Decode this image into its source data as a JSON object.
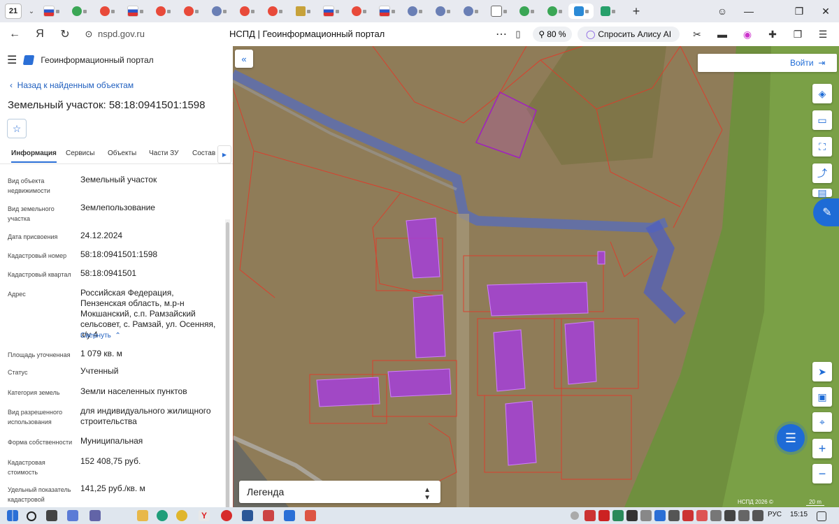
{
  "browser": {
    "tab_count": "21",
    "url": "nspd.gov.ru",
    "page_title": "НСПД | Геоинформационный портал",
    "zoom": "80 %",
    "alice_label": "Спросить Алису AI"
  },
  "panel": {
    "portal_title": "Геоинформационный портал",
    "back_label": "Назад к найденным объектам",
    "object_title": "Земельный участок: 58:18:0941501:1598",
    "tabs": [
      "Информация",
      "Сервисы",
      "Объекты",
      "Части ЗУ",
      "Состав"
    ],
    "fields": [
      {
        "label": "Вид объекта недвижимости",
        "value": "Земельный участок"
      },
      {
        "label": "Вид земельного участка",
        "value": "Землепользование"
      },
      {
        "label": "Дата присвоения",
        "value": "24.12.2024"
      },
      {
        "label": "Кадастровый номер",
        "value": "58:18:0941501:1598"
      },
      {
        "label": "Кадастровый квартал",
        "value": "58:18:0941501"
      },
      {
        "label": "Адрес",
        "value": "Российская Федерация, Пензенская область, м.р-н Мокшанский, с.п. Рамзайский сельсовет, с. Рамзай, ул. Осенняя, з/у 4"
      },
      {
        "label": "Площадь уточненная",
        "value": "1 079 кв. м"
      },
      {
        "label": "Статус",
        "value": "Учтенный"
      },
      {
        "label": "Категория земель",
        "value": "Земли населенных пунктов"
      },
      {
        "label": "Вид разрешенного использования",
        "value": "для индивидуального жилищного строительства"
      },
      {
        "label": "Форма собственности",
        "value": "Муниципальная"
      },
      {
        "label": "Кадастровая стоимость",
        "value": "152 408,75 руб."
      },
      {
        "label": "Удельный показатель кадастровой",
        "value": "141,25 руб./кв. м"
      }
    ],
    "collapse_label": "Свернуть"
  },
  "map": {
    "login_label": "Войти",
    "legend_label": "Легенда",
    "copyright": "НСПД 2026 ©",
    "scale_label": "20 m"
  },
  "taskbar": {
    "lang": "РУС",
    "time": "15:15"
  }
}
